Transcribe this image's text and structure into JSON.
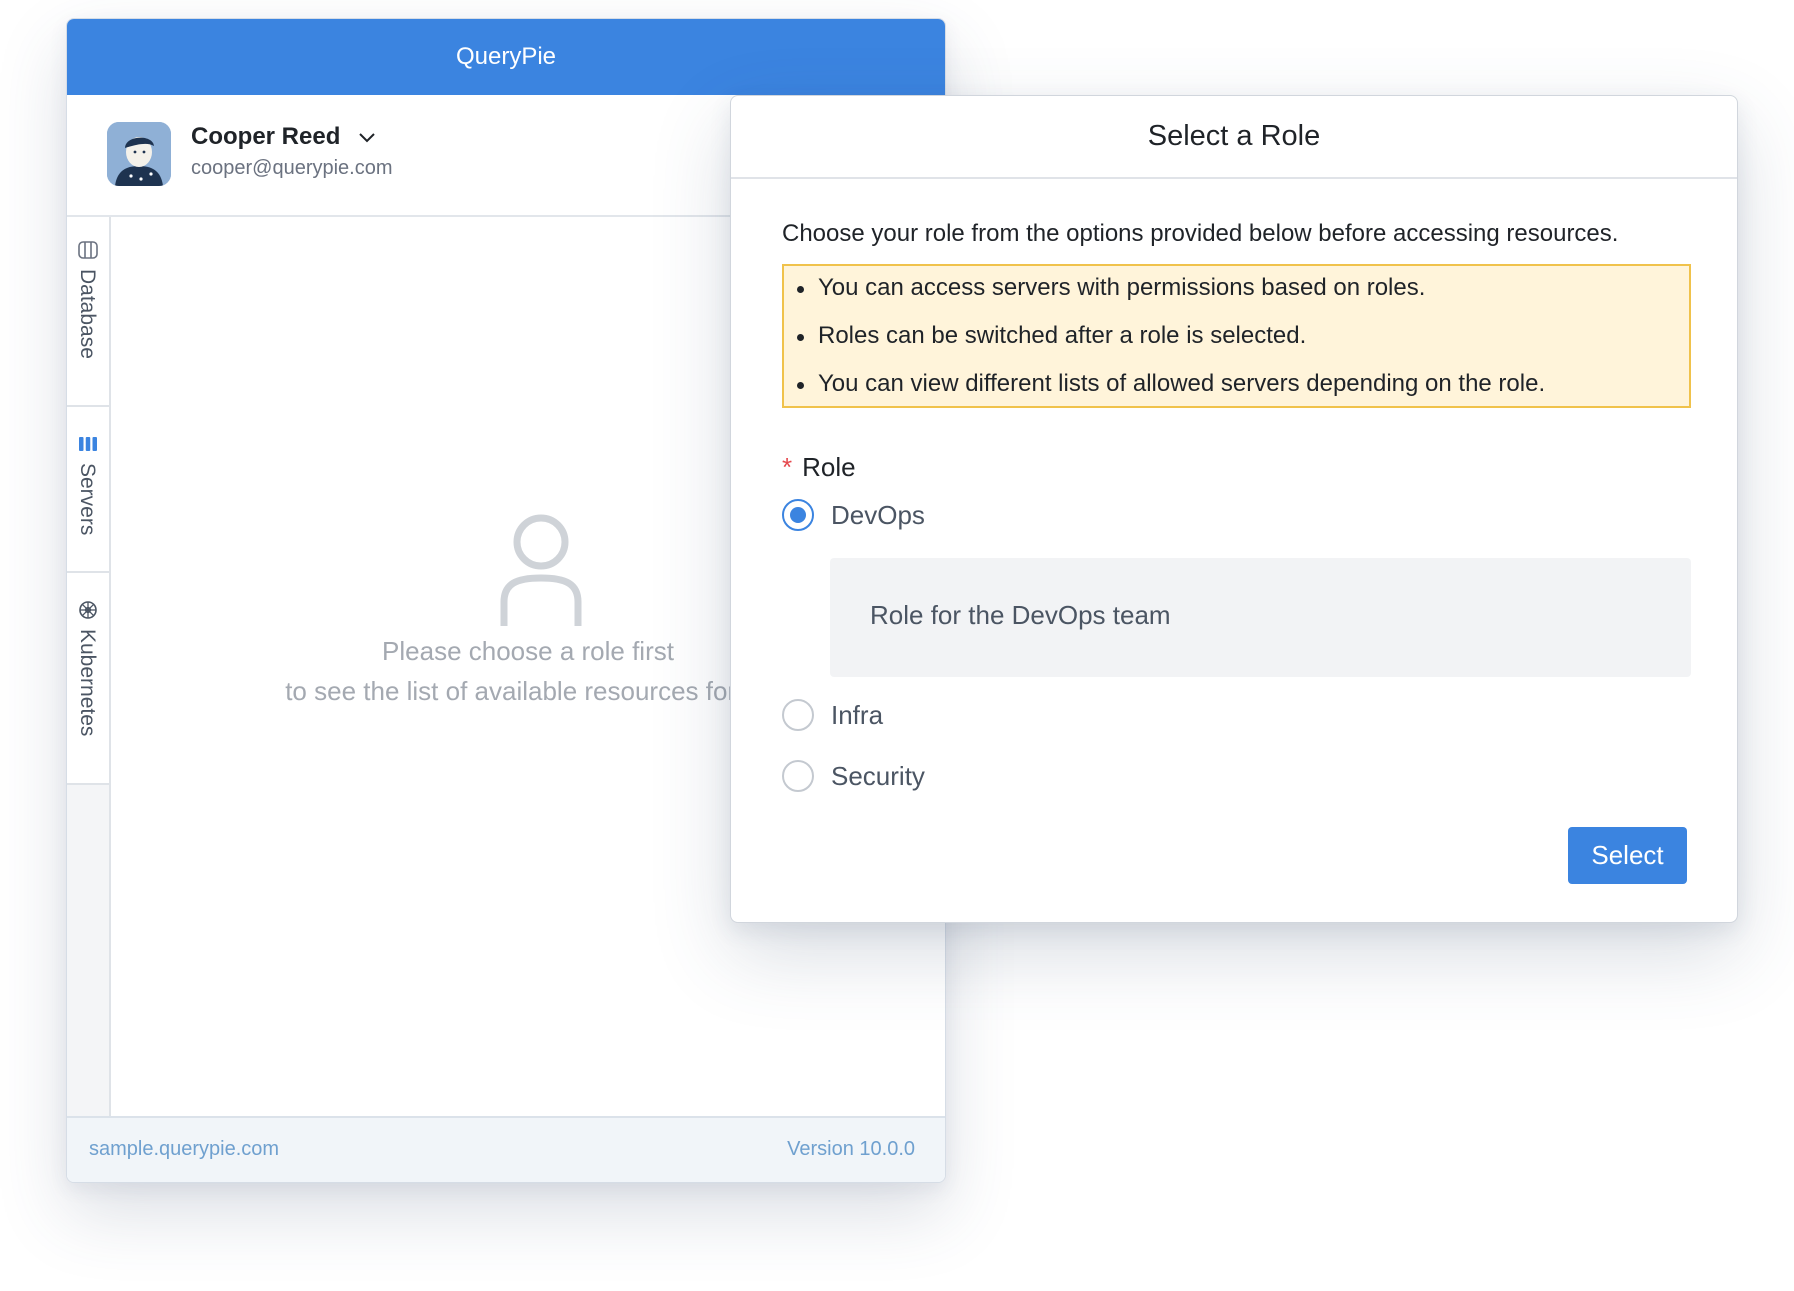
{
  "app": {
    "title": "QueryPie",
    "user": {
      "name": "Cooper Reed",
      "email": "cooper@querypie.com"
    },
    "side_tabs": [
      {
        "label": "Database",
        "icon": "database-icon"
      },
      {
        "label": "Servers",
        "icon": "servers-icon",
        "active": true
      },
      {
        "label": "Kubernetes",
        "icon": "kubernetes-icon"
      }
    ],
    "empty_state": {
      "line1": "Please choose a role first",
      "line2": "to see the list of available resources for ac"
    },
    "footer": {
      "domain": "sample.querypie.com",
      "version": "Version 10.0.0"
    }
  },
  "modal": {
    "title": "Select a Role",
    "intro": "Choose your role from the options provided below before accessing resources.",
    "notices": [
      "You can access servers with permissions based on roles.",
      "Roles can be switched after a role is selected.",
      "You can view different lists of allowed servers depending on the role."
    ],
    "role_label": "Role",
    "required_mark": "*",
    "options": [
      {
        "label": "DevOps",
        "selected": true,
        "description": "Role for the DevOps team"
      },
      {
        "label": "Infra",
        "selected": false
      },
      {
        "label": "Security",
        "selected": false
      }
    ],
    "select_button": "Select"
  },
  "colors": {
    "accent": "#3b84e0",
    "notice_bg": "#fff4da",
    "notice_border": "#f0c24b",
    "required": "#e5484d",
    "footer_text": "#6fa0cf"
  }
}
